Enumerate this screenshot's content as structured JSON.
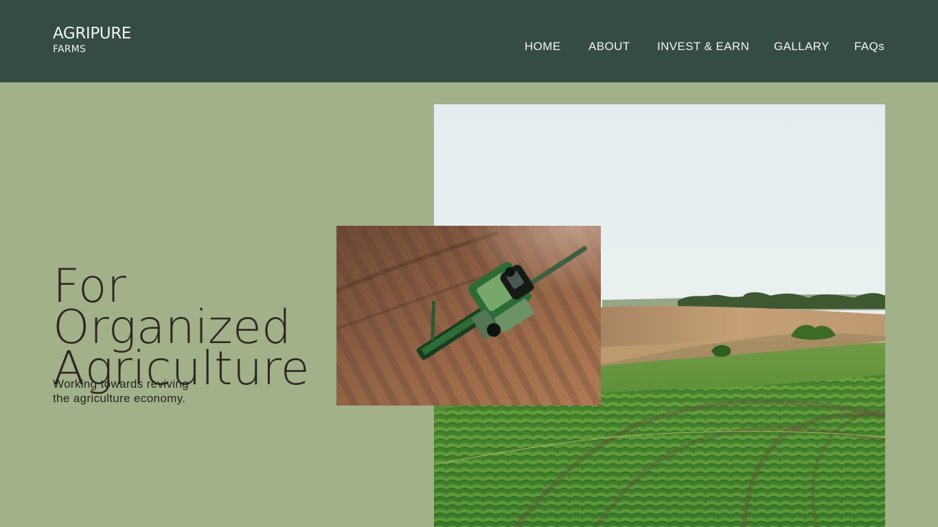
{
  "brand": {
    "name": "AGRIPURE",
    "subname": "FARMS"
  },
  "navigation": {
    "items": [
      {
        "label": "HOME"
      },
      {
        "label": "ABOUT"
      },
      {
        "label": "INVEST & EARN"
      },
      {
        "label": "GALLARY"
      },
      {
        "label": "FAQs"
      }
    ]
  },
  "hero": {
    "title_lines": [
      "For",
      "Organized",
      "Agriculture"
    ],
    "subtitle_lines": [
      "Working towards reviving",
      "the agriculture economy."
    ]
  },
  "images": {
    "field_photo": "green-farmland-landscape-photo",
    "harvester_photo": "aerial-combine-harvester-photo"
  },
  "colors": {
    "header_background": "#354c42",
    "page_background": "#a2b189",
    "header_text": "#f5f5f0",
    "hero_text": "#2c2824"
  }
}
